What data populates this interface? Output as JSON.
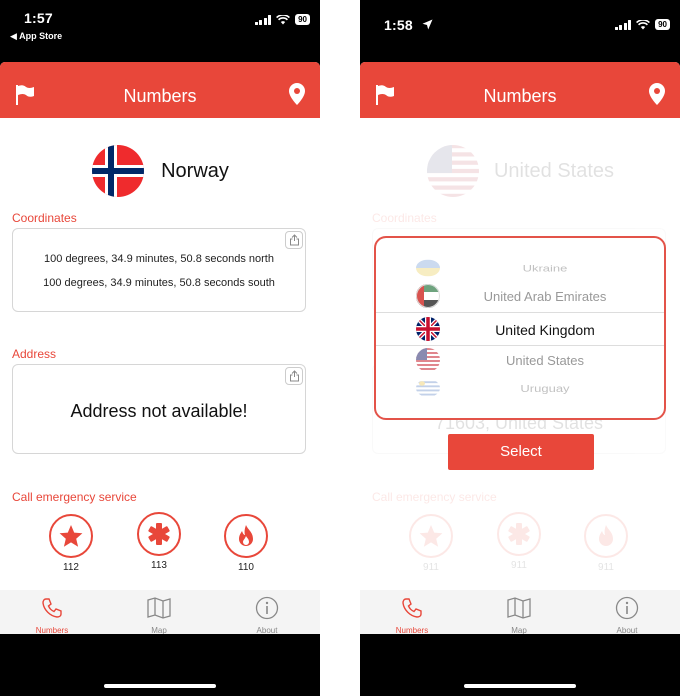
{
  "left": {
    "status": {
      "time": "1:57",
      "back_label": "◀ App Store",
      "battery": "90"
    },
    "nav": {
      "title": "Numbers"
    },
    "country": {
      "name": "Norway"
    },
    "coordinates": {
      "label": "Coordinates",
      "line1": "100 degrees, 34.9 minutes, 50.8 seconds north",
      "line2": "100 degrees, 34.9 minutes, 50.8 seconds south"
    },
    "address": {
      "label": "Address",
      "text": "Address not available!"
    },
    "emergency": {
      "label": "Call emergency service",
      "services": [
        {
          "icon": "star-icon",
          "number": "112"
        },
        {
          "icon": "medical-icon",
          "number": "113"
        },
        {
          "icon": "fire-icon",
          "number": "110"
        }
      ]
    },
    "tabs": [
      {
        "label": "Numbers",
        "icon": "phone-icon",
        "active": true
      },
      {
        "label": "Map",
        "icon": "map-icon",
        "active": false
      },
      {
        "label": "About",
        "icon": "info-icon",
        "active": false
      }
    ]
  },
  "right": {
    "status": {
      "time": "1:58",
      "battery": "90"
    },
    "nav": {
      "title": "Numbers"
    },
    "country": {
      "name": "United States"
    },
    "coordinates": {
      "label": "Coordinates"
    },
    "address": {
      "text": "71603, United States"
    },
    "emergency": {
      "label": "Call emergency service",
      "services": [
        {
          "icon": "star-icon",
          "number": "911"
        },
        {
          "icon": "medical-icon",
          "number": "911"
        },
        {
          "icon": "fire-icon",
          "number": "911"
        }
      ]
    },
    "picker": {
      "items": [
        "Ukraine",
        "United Arab Emirates",
        "United Kingdom",
        "United States",
        "Uruguay"
      ],
      "selected": "United Kingdom"
    },
    "select_label": "Select",
    "tabs": [
      {
        "label": "Numbers",
        "icon": "phone-icon",
        "active": true
      },
      {
        "label": "Map",
        "icon": "map-icon",
        "active": false
      },
      {
        "label": "About",
        "icon": "info-icon",
        "active": false
      }
    ]
  },
  "colors": {
    "accent": "#e8473a",
    "border": "#d6d6d6"
  }
}
